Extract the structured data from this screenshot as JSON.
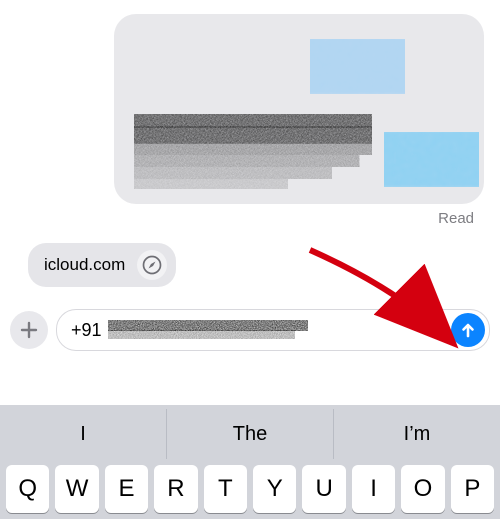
{
  "conversation": {
    "read_receipt": "Read"
  },
  "link_chip": {
    "label": "icloud.com"
  },
  "compose": {
    "prefix": "+91"
  },
  "keyboard": {
    "predictions": [
      "I",
      "The",
      "I’m"
    ],
    "row1": [
      "Q",
      "W",
      "E",
      "R",
      "T",
      "Y",
      "U",
      "I",
      "O",
      "P"
    ]
  }
}
